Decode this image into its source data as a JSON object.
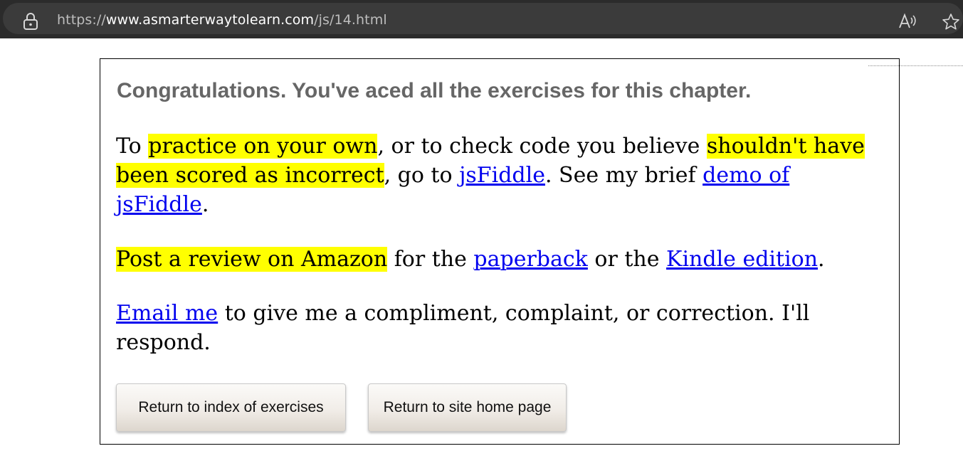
{
  "browser": {
    "url_scheme": "https://",
    "url_host": "www.asmarterwaytolearn.com",
    "url_path": "/js/14.html",
    "icons": [
      "lock-icon",
      "read-aloud-icon",
      "favorite-star-icon"
    ]
  },
  "content": {
    "heading": "Congratulations. You've aced all the exercises for this chapter.",
    "practice": {
      "t1": "To ",
      "h1": "practice on your own",
      "t2": ", or to check code you believe ",
      "h2": "shouldn't have been scored as incorrect",
      "t3": ", go to ",
      "link_jsfiddle": "jsFiddle",
      "t4": ". See my brief ",
      "link_demo": "demo of jsFiddle",
      "t5": "."
    },
    "review": {
      "h1": "Post a review on Amazon",
      "t1": " for the ",
      "link_paperback": "paperback",
      "t2": " or the ",
      "link_kindle": "Kindle edition",
      "t3": "."
    },
    "email": {
      "link_email": "Email me",
      "t1": " to give me a compliment, complaint, or correction. I'll respond."
    },
    "buttons": {
      "index_label": "Return to index of exercises",
      "home_label": "Return to site home page"
    }
  },
  "colors": {
    "highlight": "#ffff00",
    "link": "#0000ee",
    "heading": "#666666"
  }
}
